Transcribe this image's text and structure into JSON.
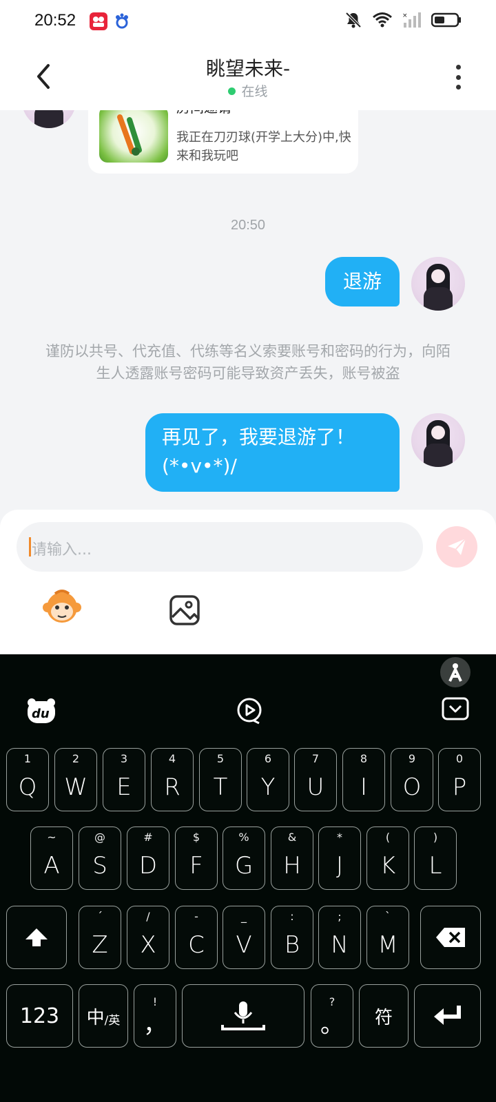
{
  "status_bar": {
    "time": "20:52",
    "app_badges": [
      "video-app-badge",
      "baidu-app-badge"
    ],
    "icons": [
      "mute-bell-icon",
      "wifi-icon",
      "signal-icon",
      "battery-icon"
    ]
  },
  "header": {
    "title": "眺望未来-",
    "status": "在线",
    "status_color": "#2ecc71"
  },
  "chat": {
    "game_card": {
      "title": "房间邀请",
      "description": "我正在刀刃球(开学上大分)中,快来和我玩吧"
    },
    "timestamp": "20:50",
    "messages": [
      {
        "text": "退游"
      },
      {
        "text": "再见了，我要退游了！(*•v•*)/"
      }
    ],
    "notice": "谨防以共号、代充值、代练等名义索要账号和密码的行为，向陌生人透露账号密码可能导致资产丢失，账号被盗",
    "bubble_color": "#21b0f5"
  },
  "composer": {
    "placeholder": "请输入...",
    "tools": [
      "emoji-monkey-icon",
      "image-icon"
    ],
    "send_color": "#ffd9dc"
  },
  "keyboard": {
    "toolbar": [
      "accessibility-icon",
      "du-logo-icon",
      "video-input-icon",
      "keyboard-hide-icon"
    ],
    "row1": [
      {
        "main": "Q",
        "sub": "1"
      },
      {
        "main": "W",
        "sub": "2"
      },
      {
        "main": "E",
        "sub": "3"
      },
      {
        "main": "R",
        "sub": "4"
      },
      {
        "main": "T",
        "sub": "5"
      },
      {
        "main": "Y",
        "sub": "6"
      },
      {
        "main": "U",
        "sub": "7"
      },
      {
        "main": "I",
        "sub": "8"
      },
      {
        "main": "O",
        "sub": "9"
      },
      {
        "main": "P",
        "sub": "0"
      }
    ],
    "row2": [
      {
        "main": "A",
        "sub": "~"
      },
      {
        "main": "S",
        "sub": "@"
      },
      {
        "main": "D",
        "sub": "#"
      },
      {
        "main": "F",
        "sub": "$"
      },
      {
        "main": "G",
        "sub": "%"
      },
      {
        "main": "H",
        "sub": "&"
      },
      {
        "main": "J",
        "sub": "*"
      },
      {
        "main": "K",
        "sub": "("
      },
      {
        "main": "L",
        "sub": ")"
      }
    ],
    "row3": [
      {
        "main": "Z",
        "sub": "´"
      },
      {
        "main": "X",
        "sub": "/"
      },
      {
        "main": "C",
        "sub": "-"
      },
      {
        "main": "V",
        "sub": "_"
      },
      {
        "main": "B",
        "sub": ":"
      },
      {
        "main": "N",
        "sub": ";"
      },
      {
        "main": "M",
        "sub": "`"
      }
    ],
    "num_label": "123",
    "lang_label_main": "中",
    "lang_label_sub": "/英",
    "comma_main": "，",
    "comma_sub": "!",
    "period_main": "。",
    "period_sub": "?",
    "symbol_label": "符"
  }
}
